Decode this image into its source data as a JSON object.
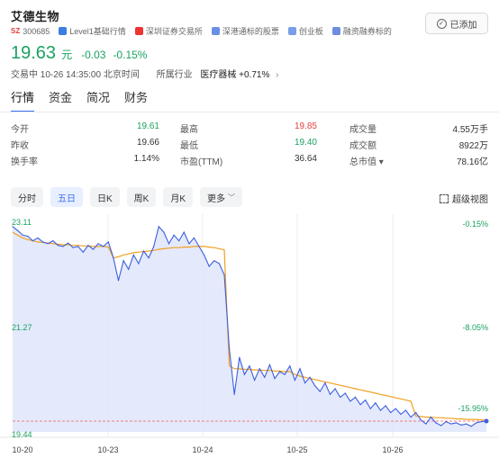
{
  "header": {
    "title": "艾德生物",
    "market_badge": "SZ",
    "code": "300685",
    "tags": [
      "Level1基础行情",
      "深圳证券交易所",
      "深港通标的股票",
      "创业板",
      "融资融券标的"
    ],
    "added_label": "已添加"
  },
  "quote": {
    "price": "19.63",
    "unit": "元",
    "change": "-0.03",
    "change_pct": "-0.15%",
    "status": "交易中 10-26 14:35:00 北京时间",
    "industry_label": "所属行业",
    "industry": "医疗器械 +0.71%",
    "industry_arrow": "›"
  },
  "tabs": [
    "行情",
    "资金",
    "简况",
    "财务"
  ],
  "stats": [
    [
      [
        "今开",
        "19.61",
        "green"
      ],
      [
        "最高",
        "19.85",
        "red"
      ],
      [
        "成交量",
        "4.55万手",
        ""
      ]
    ],
    [
      [
        "昨收",
        "19.66",
        ""
      ],
      [
        "最低",
        "19.40",
        "green"
      ],
      [
        "成交额",
        "8922万",
        ""
      ]
    ],
    [
      [
        "换手率",
        "1.14%",
        ""
      ],
      [
        "市盈(TTM)",
        "36.64",
        ""
      ],
      [
        "总市值 ▾",
        "78.16亿",
        ""
      ]
    ]
  ],
  "periods": [
    "分时",
    "五日",
    "日K",
    "周K",
    "月K",
    "更多"
  ],
  "active_period": "五日",
  "super_view": "超级视图",
  "chart_data": {
    "type": "line",
    "y_labels_left": [
      "23.11",
      "21.27",
      "19.44"
    ],
    "y_labels_right": [
      "-0.15%",
      "-8.05%",
      "-15.95%"
    ],
    "x_labels": [
      "10-20",
      "10-23",
      "10-24",
      "10-25",
      "10-26"
    ],
    "ylim": [
      19.44,
      23.11
    ],
    "baseline": 19.63,
    "colors": {
      "price": "#3b5fe0",
      "average": "#f0a020",
      "baseline": "#f08080",
      "fill": "#dde4fb",
      "axis_text": "#1aa260"
    },
    "series": [
      {
        "values": [
          23.05,
          22.98,
          22.9,
          22.88,
          22.8,
          22.85,
          22.78,
          22.75,
          22.8,
          22.72,
          22.7,
          22.76,
          22.68,
          22.7,
          22.6,
          22.72,
          22.65,
          22.75,
          22.7,
          22.78,
          22.5,
          22.1,
          22.45,
          22.3,
          22.55,
          22.4,
          22.62,
          22.5,
          22.7,
          23.05,
          22.95,
          22.75,
          22.9,
          22.8,
          22.95,
          22.75,
          22.85,
          22.7,
          22.55,
          22.35,
          22.45,
          22.4,
          22.2,
          20.9,
          20.1,
          20.75,
          20.45,
          20.6,
          20.35,
          20.55,
          20.4,
          20.62,
          20.38,
          20.5,
          20.45,
          20.6,
          20.35,
          20.55,
          20.3,
          20.4,
          20.25,
          20.15,
          20.3,
          20.1,
          20.2,
          20.05,
          20.12,
          19.98,
          20.05,
          19.92,
          20.0,
          19.85,
          19.95,
          19.82,
          19.9,
          19.78,
          19.85,
          19.75,
          19.82,
          19.7,
          19.78,
          19.65,
          19.58,
          19.7,
          19.6,
          19.55,
          19.62,
          19.58,
          19.6,
          19.56,
          19.58,
          19.54,
          19.6,
          19.62,
          19.63
        ]
      },
      {
        "values": [
          22.95,
          22.9,
          22.85,
          22.82,
          22.8,
          22.78,
          22.77,
          22.76,
          22.75,
          22.74,
          22.73,
          22.73,
          22.72,
          22.72,
          22.71,
          22.71,
          22.7,
          22.7,
          22.7,
          22.69,
          22.5,
          22.52,
          22.55,
          22.57,
          22.59,
          22.6,
          22.61,
          22.62,
          22.63,
          22.65,
          22.66,
          22.67,
          22.68,
          22.68,
          22.69,
          22.69,
          22.7,
          22.7,
          22.7,
          22.69,
          22.68,
          22.66,
          22.64,
          20.6,
          20.55,
          20.55,
          20.54,
          20.54,
          20.53,
          20.53,
          20.52,
          20.52,
          20.51,
          20.51,
          20.5,
          20.5,
          20.45,
          20.42,
          20.4,
          20.38,
          20.36,
          20.34,
          20.32,
          20.3,
          20.28,
          20.26,
          20.24,
          20.22,
          20.2,
          20.18,
          20.16,
          20.14,
          20.12,
          20.1,
          20.08,
          20.06,
          20.04,
          20.02,
          20.0,
          19.98,
          19.72,
          19.71,
          19.7,
          19.7,
          19.69,
          19.69,
          19.68,
          19.68,
          19.67,
          19.67,
          19.66,
          19.66,
          19.66,
          19.65,
          19.65
        ]
      }
    ]
  }
}
